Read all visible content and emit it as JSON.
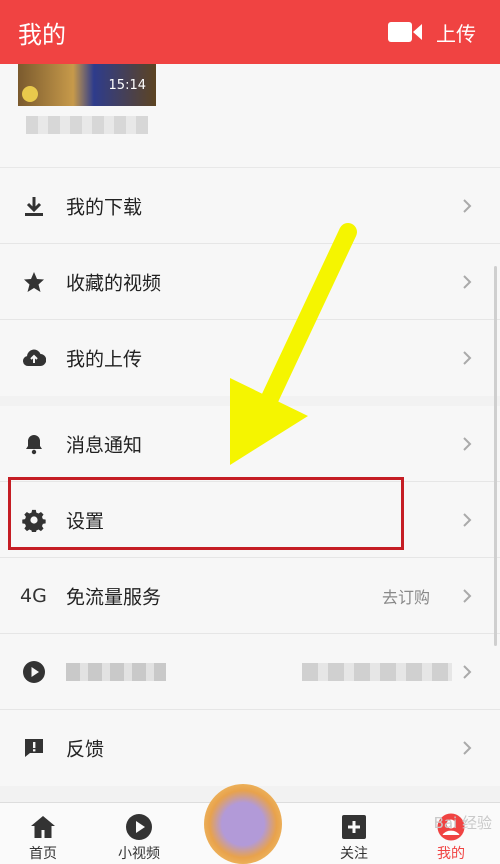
{
  "header": {
    "title": "我的",
    "upload_label": "上传"
  },
  "profile": {
    "video_duration": "15:14"
  },
  "menu": {
    "downloads": "我的下载",
    "favorites": "收藏的视频",
    "uploads": "我的上传",
    "notifications": "消息通知",
    "settings": "设置",
    "data_service_icon": "4G",
    "data_service": "免流量服务",
    "data_service_action": "去订购",
    "feedback": "反馈"
  },
  "nav": {
    "home": "首页",
    "shorts": "小视频",
    "follow": "关注",
    "mine": "我的"
  },
  "colors": {
    "header": "#f04342",
    "highlight_box": "#c51d24",
    "arrow": "#f5f500"
  }
}
